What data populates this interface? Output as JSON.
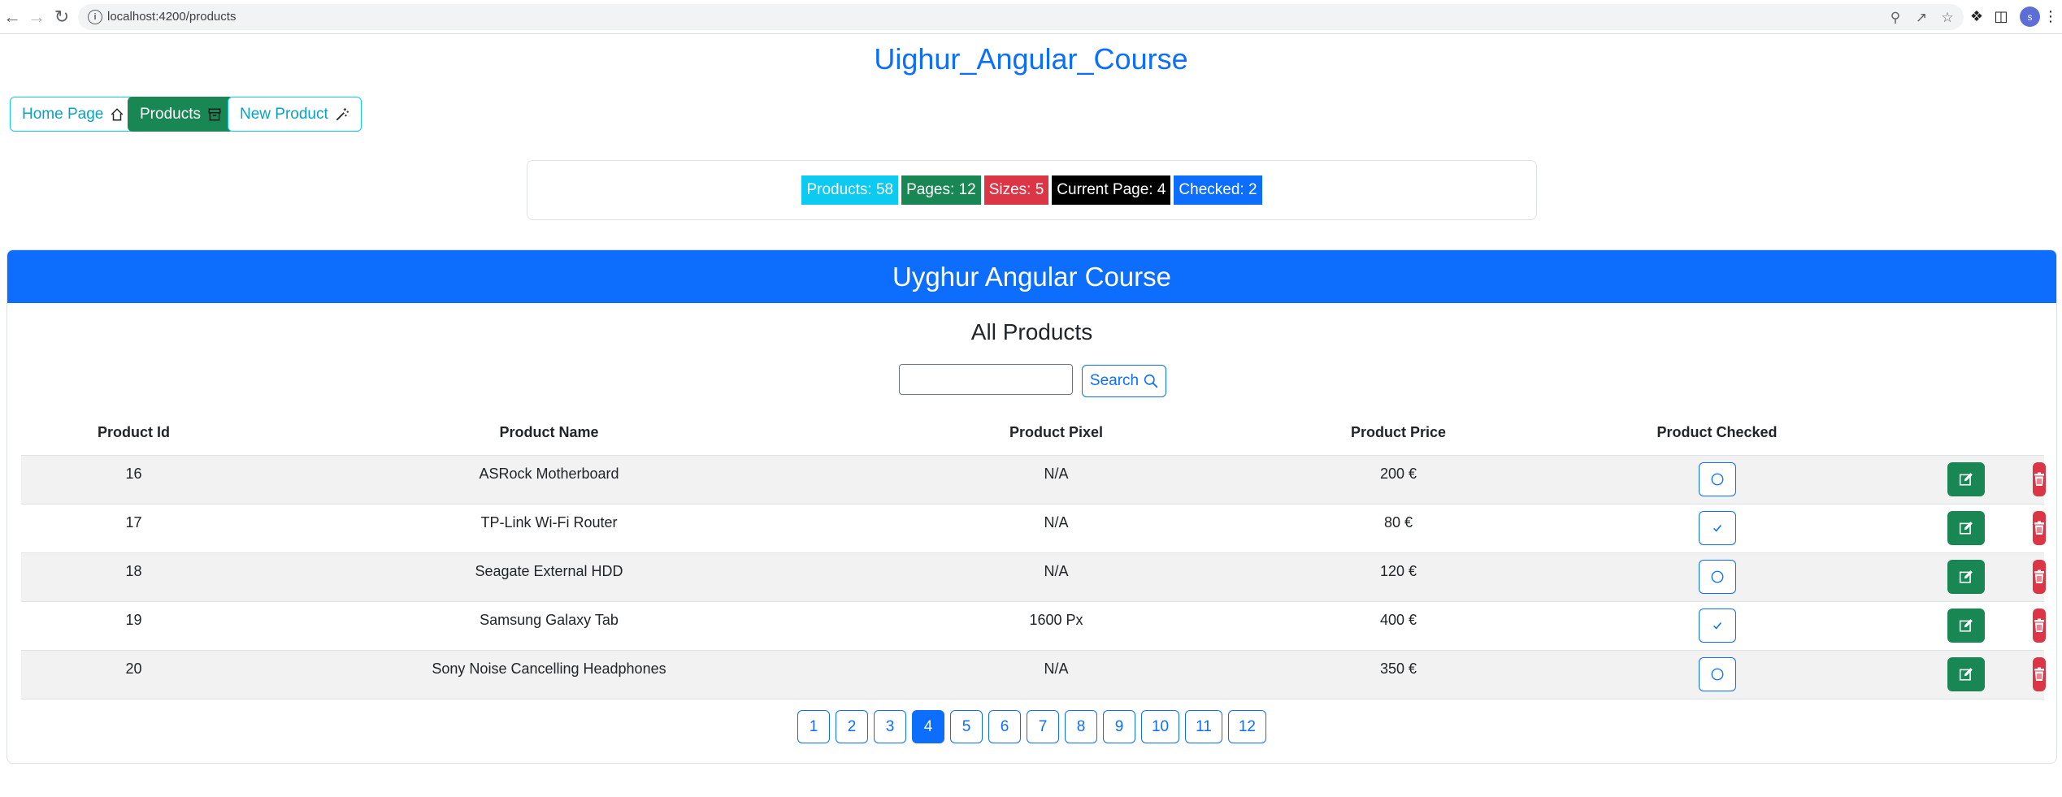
{
  "browser": {
    "url": "localhost:4200/products",
    "profile_initial": "s"
  },
  "app": {
    "title": "Uighur_Angular_Course"
  },
  "nav": {
    "home": "Home Page",
    "products": "Products",
    "new_product": "New Product"
  },
  "stats": {
    "products": "Products: 58",
    "pages": "Pages: 12",
    "sizes": "Sizes: 5",
    "current_page": "Current Page: 4",
    "checked": "Checked: 2"
  },
  "card": {
    "header": "Uyghur Angular Course",
    "title": "All Products",
    "search_value": "",
    "search_label": "Search"
  },
  "table": {
    "columns": [
      "Product Id",
      "Product Name",
      "Product Pixel",
      "Product Price",
      "Product Checked"
    ],
    "rows": [
      {
        "id": "16",
        "name": "ASRock Motherboard",
        "pixel": "N/A",
        "price": "200 €",
        "checked": false
      },
      {
        "id": "17",
        "name": "TP-Link Wi-Fi Router",
        "pixel": "N/A",
        "price": "80 €",
        "checked": true
      },
      {
        "id": "18",
        "name": "Seagate External HDD",
        "pixel": "N/A",
        "price": "120 €",
        "checked": false
      },
      {
        "id": "19",
        "name": "Samsung Galaxy Tab",
        "pixel": "1600 Px",
        "price": "400 €",
        "checked": true
      },
      {
        "id": "20",
        "name": "Sony Noise Cancelling Headphones",
        "pixel": "N/A",
        "price": "350 €",
        "checked": false
      }
    ]
  },
  "pagination": {
    "pages": [
      "1",
      "2",
      "3",
      "4",
      "5",
      "6",
      "7",
      "8",
      "9",
      "10",
      "11",
      "12"
    ],
    "active": "4"
  },
  "colors": {
    "primary": "#0d6efd",
    "success": "#198754",
    "danger": "#dc3545",
    "info": "#0dcaf0",
    "dark": "#000000"
  }
}
